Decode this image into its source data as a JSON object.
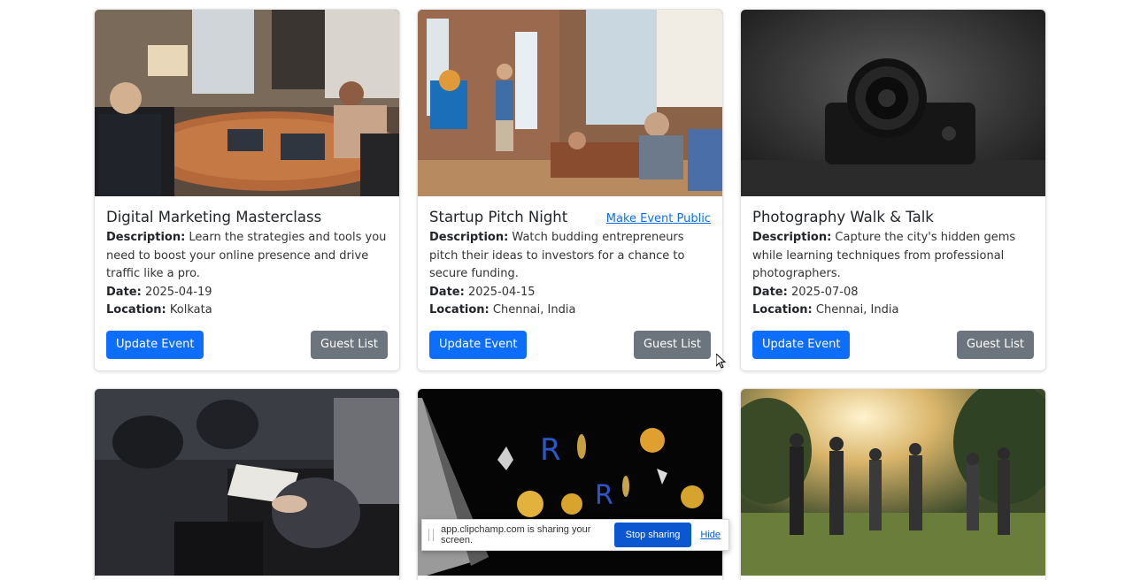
{
  "events": [
    {
      "title": "Digital Marketing Masterclass",
      "public_link": "",
      "description_label": "Description:",
      "description": "Learn the strategies and tools you need to boost your online presence and drive traffic like a pro.",
      "date_label": "Date:",
      "date": "2025-04-19",
      "location_label": "Location:",
      "location": "Kolkata",
      "update_label": "Update Event",
      "guest_label": "Guest List",
      "image": "conference-room-meeting-photo"
    },
    {
      "title": "Startup Pitch Night",
      "public_link": "Make Event Public",
      "description_label": "Description:",
      "description": "Watch budding entrepreneurs pitch their ideas to investors for a chance to secure funding.",
      "date_label": "Date:",
      "date": "2025-04-15",
      "location_label": "Location:",
      "location": "Chennai, India",
      "update_label": "Update Event",
      "guest_label": "Guest List",
      "image": "startup-presentation-photo"
    },
    {
      "title": "Photography Walk & Talk",
      "public_link": "",
      "description_label": "Description:",
      "description": "Capture the city's hidden gems while learning techniques from professional photographers.",
      "date_label": "Date:",
      "date": "2025-07-08",
      "location_label": "Location:",
      "location": "Chennai, India",
      "update_label": "Update Event",
      "guest_label": "Guest List",
      "image": "vintage-camera-photo"
    },
    {
      "image": "audience-notetaking-photo"
    },
    {
      "image": "crypto-coins-photo"
    },
    {
      "image": "outdoor-yoga-photo"
    }
  ],
  "screen_share": {
    "message": "app.clipchamp.com is sharing your screen.",
    "stop_label": "Stop sharing",
    "hide_label": "Hide"
  },
  "colors": {
    "primary": "#0d6efd",
    "secondary": "#6c757d",
    "link": "#0d6efd"
  }
}
